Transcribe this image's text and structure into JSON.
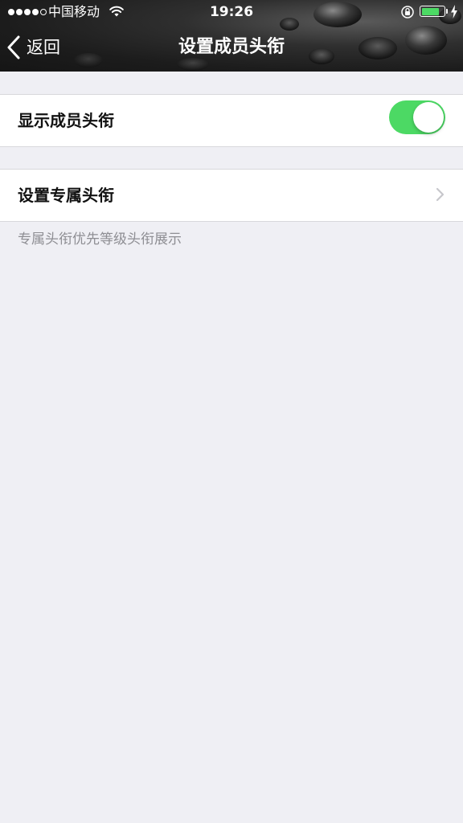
{
  "status_bar": {
    "carrier": "中国移动",
    "time": "19:26",
    "battery_fill": 0.8
  },
  "nav": {
    "back_label": "返回",
    "title": "设置成员头衔"
  },
  "settings": {
    "show_titles": {
      "label": "显示成员头衔",
      "enabled": true
    },
    "custom_title": {
      "label": "设置专属头衔"
    },
    "note": "专属头衔优先等级头衔展示"
  },
  "colors": {
    "toggle_on": "#4cd964",
    "battery": "#4cd964",
    "background": "#efeff4",
    "note_text": "#8e8e93"
  },
  "icons": {
    "back": "chevron-left-icon",
    "disclosure": "chevron-right-icon",
    "wifi": "wifi-icon",
    "lock": "rotation-lock-icon",
    "charging": "charging-bolt-icon"
  }
}
